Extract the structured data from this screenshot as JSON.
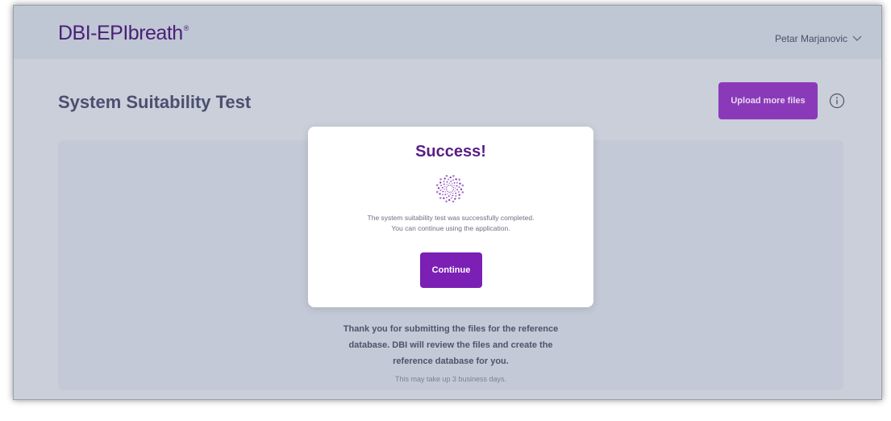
{
  "header": {
    "logo_text": "DBI-EPIbreath",
    "logo_mark": "®",
    "user_name": "Petar Marjanovic",
    "user_menu_icon": "chevron-down-icon"
  },
  "page": {
    "title": "System Suitability Test",
    "upload_button": "Upload more files",
    "info_icon": "info-icon"
  },
  "content": {
    "thanks_lines": [
      "Thank you for submitting the files for the reference",
      "database. DBI will review the files and create the",
      "reference database for you."
    ],
    "note": "This may take up 3 business days."
  },
  "modal": {
    "title": "Success!",
    "icon": "spinner-icon",
    "message_lines": [
      "The system suitability test was successfully completed.",
      "You can continue using the application."
    ],
    "continue_button": "Continue"
  },
  "colors": {
    "brand_purple": "#7b1fb5",
    "logo_purple": "#4a1f77",
    "background": "#cacfda"
  }
}
